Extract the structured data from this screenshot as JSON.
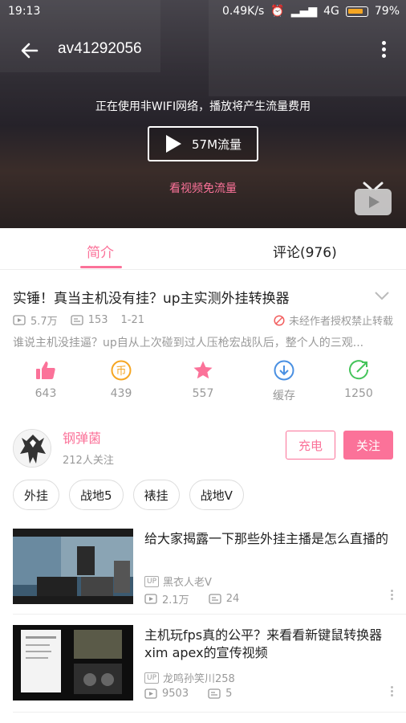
{
  "status": {
    "time": "19:13",
    "speed": "0.49K/s",
    "network": "4G",
    "battery": "79%"
  },
  "video": {
    "title": "av41292056",
    "notice": "正在使用非WIFI网络，播放将产生流量费用",
    "play_label": "57M流量",
    "free_label": "看视频免流量"
  },
  "tabs": [
    {
      "label": "简介"
    },
    {
      "label": "评论(976)"
    }
  ],
  "info": {
    "title": "实锤！真当主机没有挂？up主实测外挂转换器",
    "views": "5.7万",
    "danmaku": "153",
    "date": "1-21",
    "warning": "未经作者授权禁止转载",
    "description": "谁说主机没挂逼？up自从上次碰到过人压枪宏战队后，整个人的三观..."
  },
  "actions": [
    {
      "label": "643",
      "icon": "like-icon",
      "color": "#fb7299"
    },
    {
      "label": "439",
      "icon": "coin-icon",
      "color": "#f5a623"
    },
    {
      "label": "557",
      "icon": "star-icon",
      "color": "#fb7299"
    },
    {
      "label": "缓存",
      "icon": "download-icon",
      "color": "#4a90e2"
    },
    {
      "label": "1250",
      "icon": "share-icon",
      "color": "#45c45b"
    }
  ],
  "uploader": {
    "name": "钢弹菌",
    "followers": "212人关注",
    "charge_label": "充电",
    "follow_label": "关注"
  },
  "tags": [
    "外挂",
    "战地5",
    "裱挂",
    "战地V"
  ],
  "related": [
    {
      "title": "给大家揭露一下那些外挂主播是怎么直播的",
      "up_badge": "UP",
      "uploader": "黑衣人老V",
      "views": "2.1万",
      "danmaku": "24"
    },
    {
      "title": "主机玩fps真的公平？来看看新键鼠转换器xim apex的宣传视频",
      "up_badge": "UP",
      "uploader": "龙鸣孙笑川258",
      "views": "9503",
      "danmaku": "5"
    }
  ]
}
